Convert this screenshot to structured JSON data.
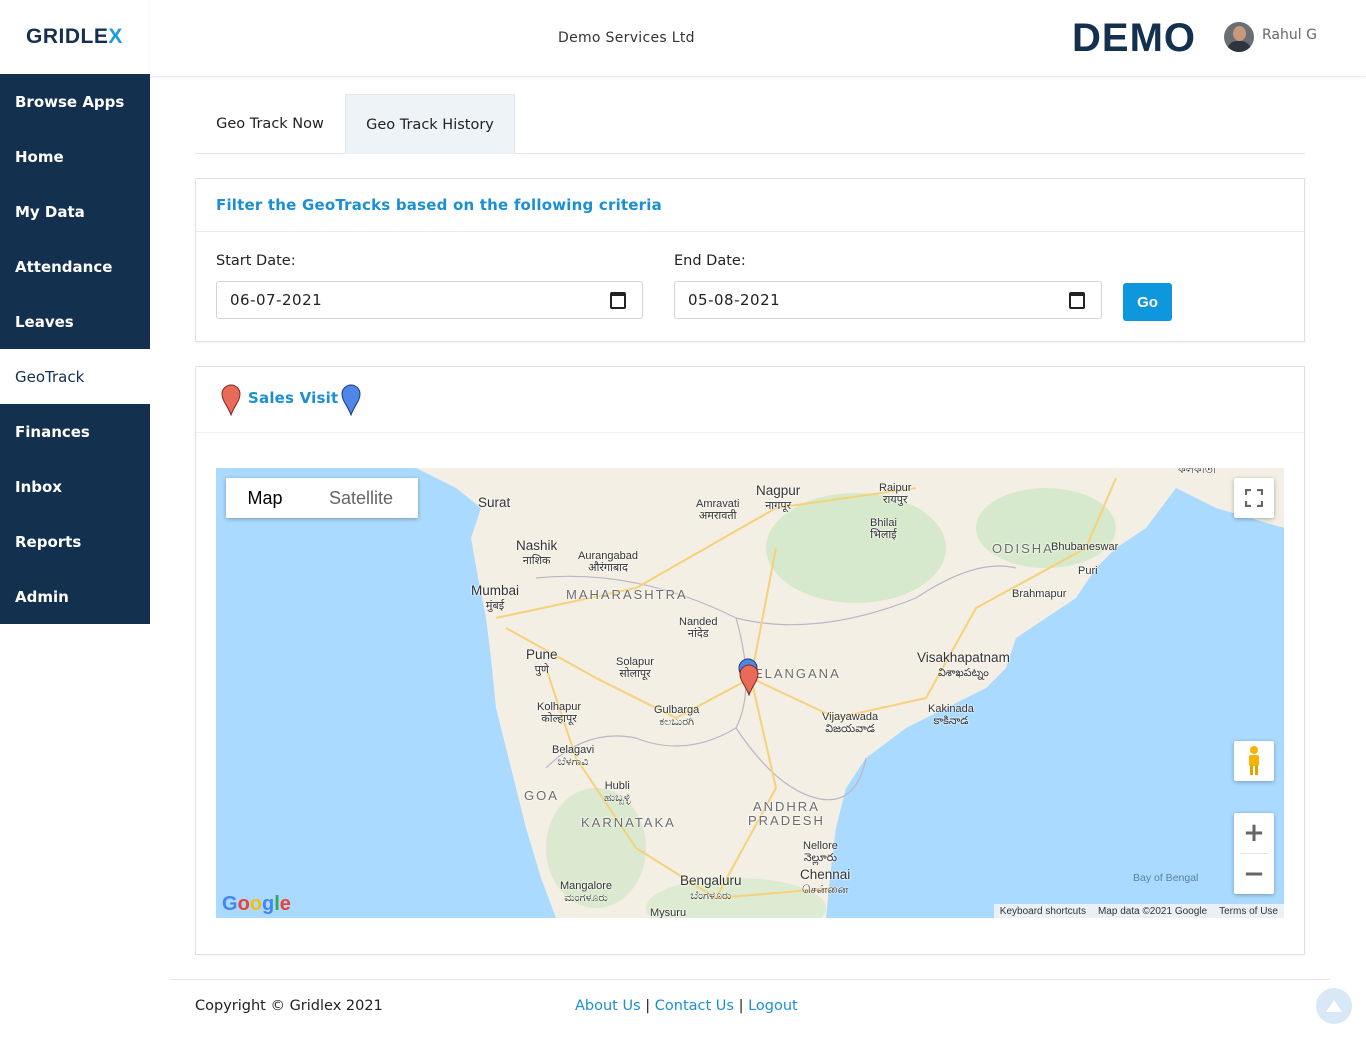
{
  "app": {
    "logo": {
      "prefix": "GRIDLE",
      "accent": "X"
    },
    "company": "Demo Services Ltd",
    "brand": "DEMO",
    "user": "Rahul G"
  },
  "sidebar": {
    "items": [
      {
        "label": "Browse Apps",
        "active": false
      },
      {
        "label": "Home",
        "active": false
      },
      {
        "label": "My Data",
        "active": false
      },
      {
        "label": "Attendance",
        "active": false
      },
      {
        "label": "Leaves",
        "active": false
      },
      {
        "label": "GeoTrack",
        "active": true
      },
      {
        "label": "Finances",
        "active": false
      },
      {
        "label": "Inbox",
        "active": false
      },
      {
        "label": "Reports",
        "active": false
      },
      {
        "label": "Admin",
        "active": false
      }
    ]
  },
  "tabs": [
    {
      "label": "Geo Track Now",
      "active": false
    },
    {
      "label": "Geo Track History",
      "active": true
    }
  ],
  "filter": {
    "title": "Filter the GeoTracks based on the following criteria",
    "start_label": "Start Date:",
    "start_value": "06-07-2021",
    "end_label": "End Date:",
    "end_value": "05-08-2021",
    "go_label": "Go"
  },
  "legend": {
    "label": "Sales Visit",
    "colors": {
      "sales_visit": "#ea6a5a",
      "other": "#4f86e8"
    }
  },
  "map": {
    "type_options": [
      "Map",
      "Satellite"
    ],
    "selected_type": "Map",
    "labels": {
      "surat": "Surat",
      "amravati": "Amravati",
      "amravati_local": "अमरावती",
      "nagpur": "Nagpur",
      "nagpur_local": "नागपूर",
      "raipur": "Raipur",
      "raipur_local": "रायपुर",
      "bhilai": "Bhilai",
      "bhilai_local": "भिलाई",
      "kolkata_local": "কলকাতা",
      "nashik": "Nashik",
      "nashik_local": "नाशिक",
      "aurangabad": "Aurangabad",
      "aurangabad_local": "औरंगाबाद",
      "odisha": "ODISHA",
      "bhubaneswar": "Bhubaneswar",
      "puri": "Puri",
      "mumbai": "Mumbai",
      "mumbai_local": "मुंबई",
      "maharashtra": "MAHARASHTRA",
      "brahmapur": "Brahmapur",
      "nanded": "Nanded",
      "nanded_local": "नांदेड",
      "pune": "Pune",
      "pune_local": "पुणे",
      "solapur": "Solapur",
      "solapur_local": "सोलापूर",
      "telangana": "TELANGANA",
      "visakhapatnam": "Visakhapatnam",
      "visakhapatnam_local": "విశాఖపట్నం",
      "kolhapur": "Kolhapur",
      "kolhapur_local": "कोल्हापूर",
      "gulbarga": "Gulbarga",
      "gulbarga_local": "ಕಲಬುರಗಿ",
      "vijayawada": "Vijayawada",
      "vijayawada_local": "విజయవాడ",
      "kakinada": "Kakinada",
      "kakinada_local": "కాకినాడ",
      "belagavi": "Belagavi",
      "belagavi_local": "ಬೆಳಗಾವಿ",
      "hubli": "Hubli",
      "hubli_local": "ಹುಬ್ಬಳ್ಳಿ",
      "goa": "GOA",
      "andhra": "ANDHRA",
      "pradesh": "PRADESH",
      "karnataka": "KARNATAKA",
      "nellore": "Nellore",
      "nellore_local": "నెల్లూరు",
      "chennai": "Chennai",
      "chennai_local": "சென்னை",
      "bengaluru": "Bengaluru",
      "bengaluru_local": "ಬೆಂಗಳೂರು",
      "mangalore": "Mangalore",
      "mangalore_local": "ಮಂಗಳೂರು",
      "mysuru": "Mysuru",
      "bay": "Bay of Bengal"
    },
    "attribution": {
      "shortcuts": "Keyboard shortcuts",
      "data": "Map data ©2021 Google",
      "terms": "Terms of Use"
    },
    "google_logo": "Google"
  },
  "footer": {
    "copyright": "Copyright © Gridlex 2021",
    "about": "About Us",
    "contact": "Contact Us",
    "logout": "Logout",
    "sep": "|"
  }
}
